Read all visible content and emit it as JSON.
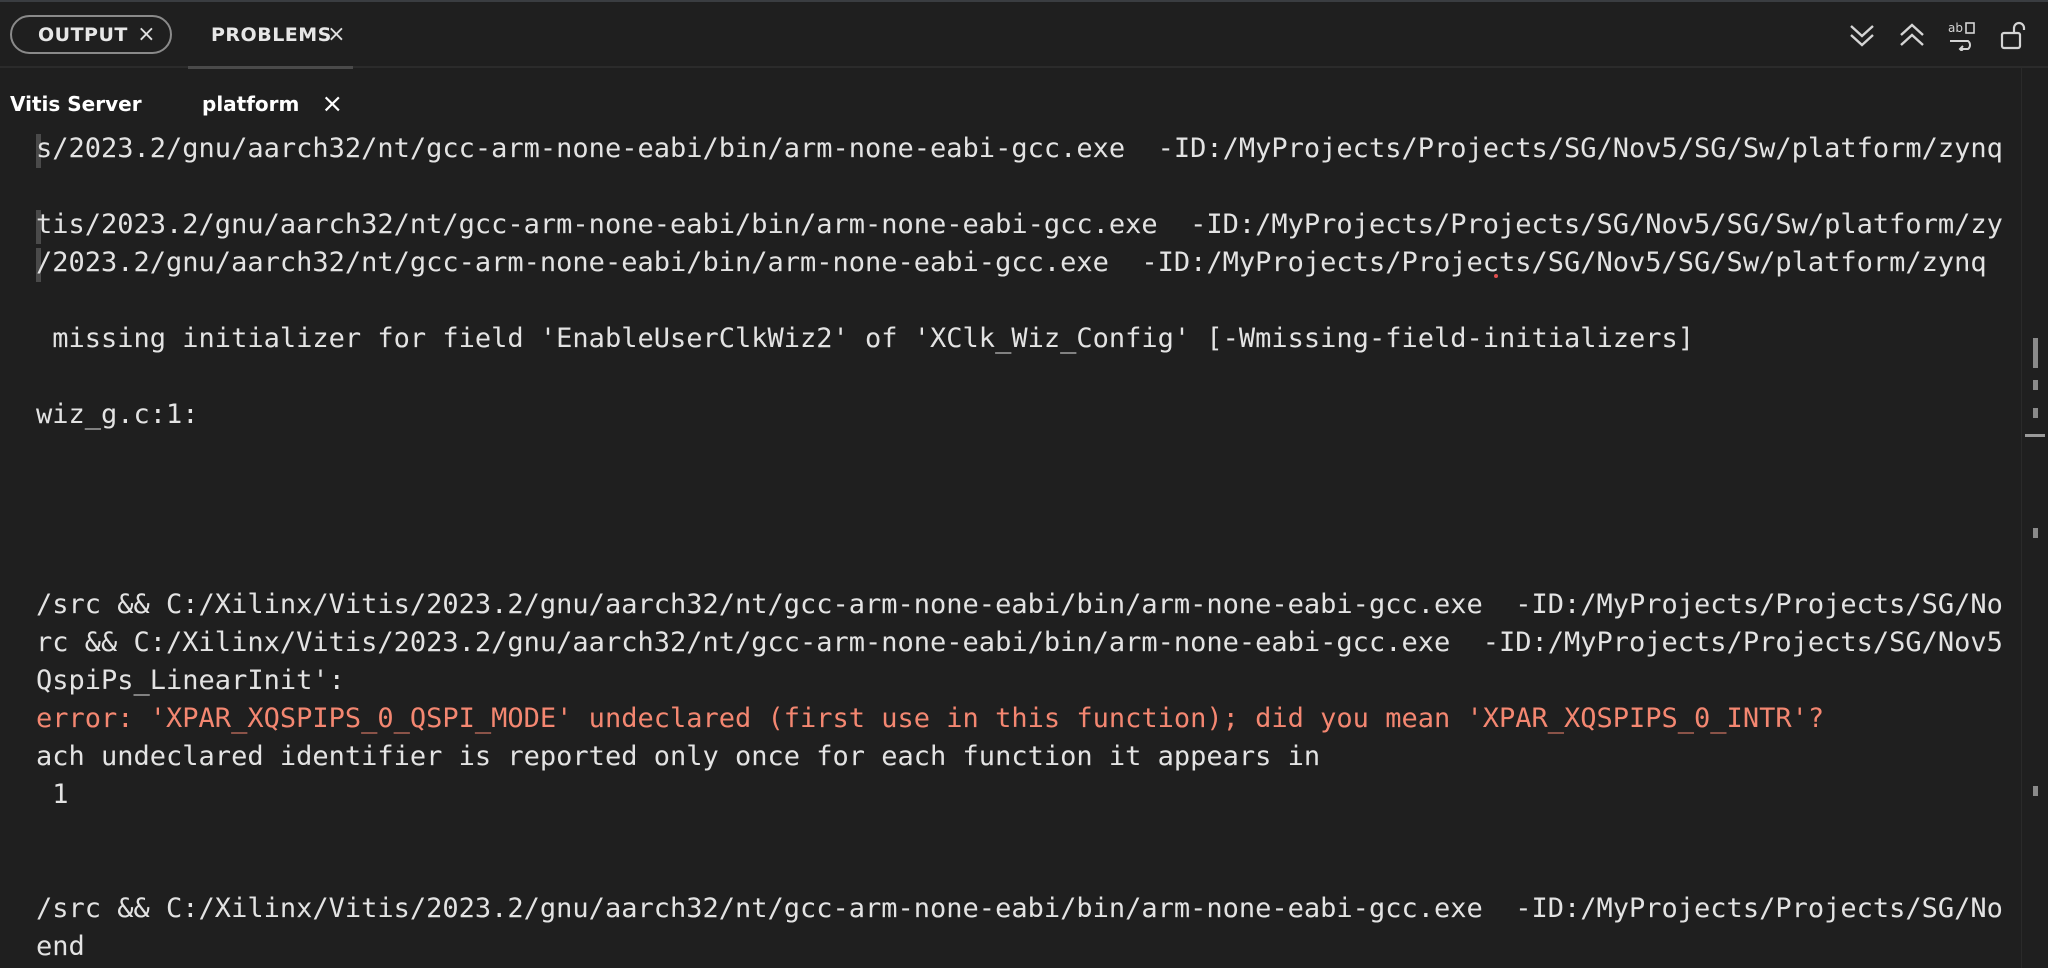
{
  "panel": {
    "tabs": [
      {
        "label": "OUTPUT",
        "close": "×"
      },
      {
        "label": "PROBLEMS",
        "close": "×"
      }
    ],
    "toolbar": [
      {
        "name": "collapse-all-icon"
      },
      {
        "name": "expand-all-icon"
      },
      {
        "name": "word-wrap-icon"
      },
      {
        "name": "lock-icon"
      }
    ]
  },
  "sub_tabs": [
    {
      "label": "Vitis Server"
    },
    {
      "label": "platform",
      "close": "×"
    }
  ],
  "output_lines": [
    "s/2023.2/gnu/aarch32/nt/gcc-arm-none-eabi/bin/arm-none-eabi-gcc.exe  -ID:/MyProjects/Projects/SG/Nov5/SG/Sw/platform/zynq",
    "",
    "tis/2023.2/gnu/aarch32/nt/gcc-arm-none-eabi/bin/arm-none-eabi-gcc.exe  -ID:/MyProjects/Projects/SG/Nov5/SG/Sw/platform/zy",
    "/2023.2/gnu/aarch32/nt/gcc-arm-none-eabi/bin/arm-none-eabi-gcc.exe  -ID:/MyProjects/Projects/SG/Nov5/SG/Sw/platform/zynq",
    "",
    " missing initializer for field 'EnableUserClkWiz2' of 'XClk_Wiz_Config' [-Wmissing-field-initializers]",
    "",
    "wiz_g.c:1:",
    "",
    "",
    "",
    "",
    "/src && C:/Xilinx/Vitis/2023.2/gnu/aarch32/nt/gcc-arm-none-eabi/bin/arm-none-eabi-gcc.exe  -ID:/MyProjects/Projects/SG/No",
    "rc && C:/Xilinx/Vitis/2023.2/gnu/aarch32/nt/gcc-arm-none-eabi/bin/arm-none-eabi-gcc.exe  -ID:/MyProjects/Projects/SG/Nov5",
    "QspiPs_LinearInit':",
    "error: 'XPAR_XQSPIPS_0_QSPI_MODE' undeclared (first use in this function); did you mean 'XPAR_XQSPIPS_0_INTR'?",
    "ach undeclared identifier is reported only once for each function it appears in",
    " 1",
    "",
    "",
    "/src && C:/Xilinx/Vitis/2023.2/gnu/aarch32/nt/gcc-arm-none-eabi/bin/arm-none-eabi-gcc.exe  -ID:/MyProjects/Projects/SG/No",
    "end"
  ],
  "error_line_index": 15,
  "colors": {
    "background": "#1f1f1f",
    "text": "#e3e3e3",
    "error": "#f48771"
  }
}
